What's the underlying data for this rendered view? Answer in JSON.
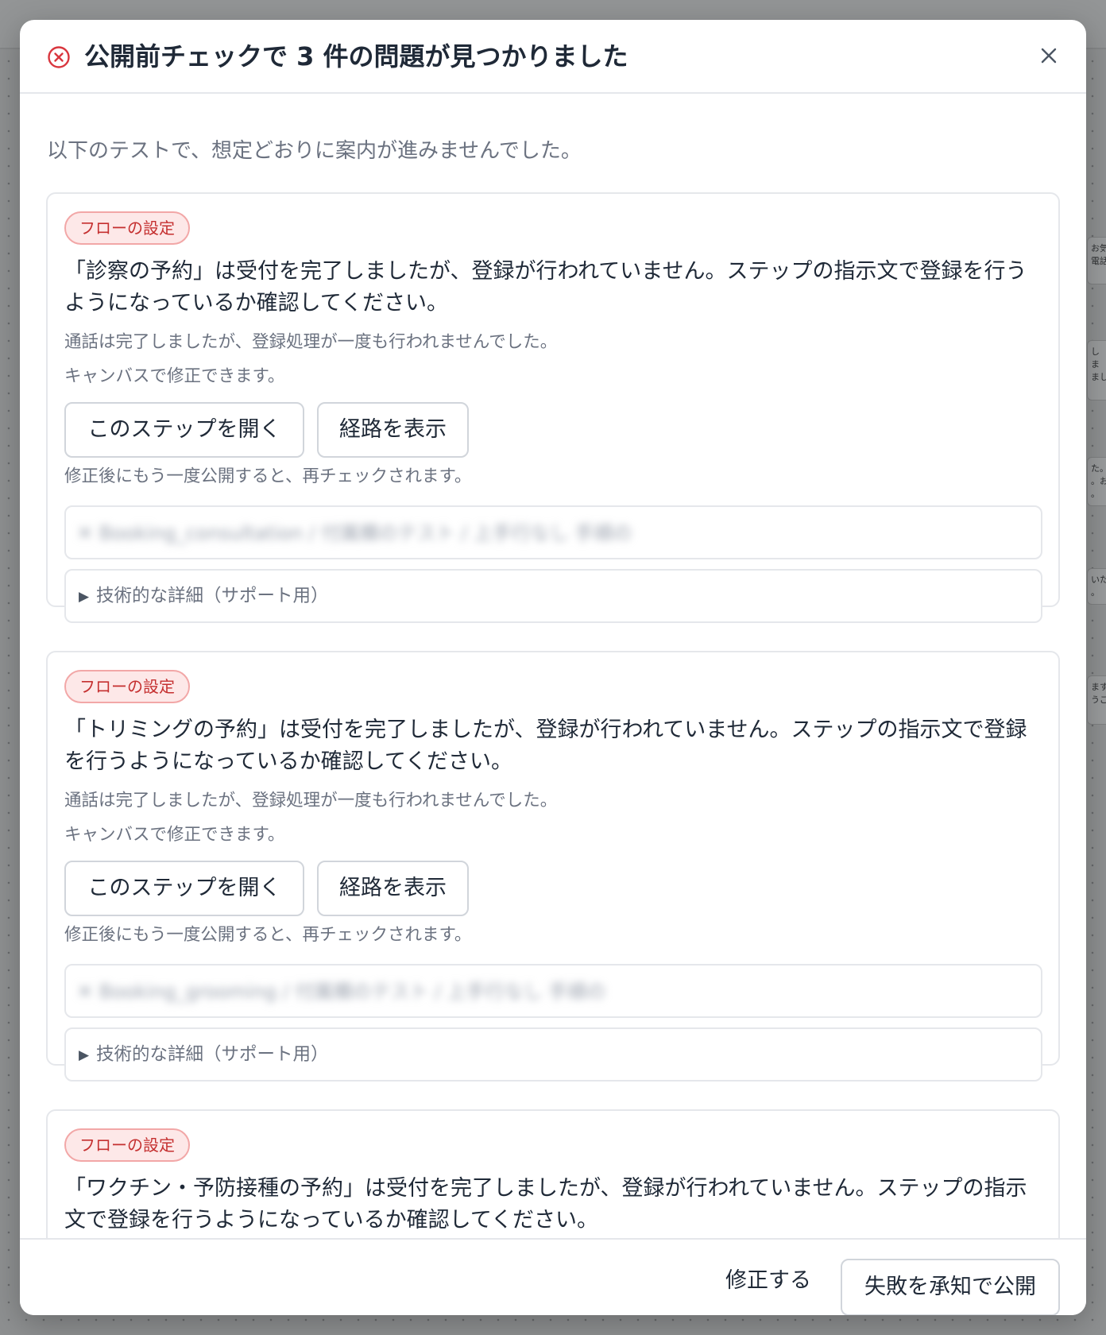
{
  "background": {
    "side_cards": [
      {
        "lines": [
          "お気",
          "電話"
        ]
      },
      {
        "lines": [
          "し",
          "ま",
          "まし"
        ]
      },
      {
        "lines": [
          "た。",
          "。お",
          "。"
        ]
      },
      {
        "lines": [
          "いた",
          "。"
        ]
      },
      {
        "lines": [
          "ます",
          "うご"
        ]
      }
    ]
  },
  "modal": {
    "title": "公開前チェックで 3 件の問題が見つかりました",
    "close_icon": "close-icon",
    "error_icon": "circle-x-icon",
    "error_color": "#d9363e",
    "intro": "以下のテストで、想定どおりに案内が進みませんでした。",
    "issues": [
      {
        "badge": "フローの設定",
        "message": "「診察の予約」は受付を完了しましたが、登録が行われていません。ステップの指示文で登録を行うようになっているか確認してください。",
        "detail_1": "通話は完了しましたが、登録処理が一度も行われませんでした。",
        "detail_2": "キャンバスで修正できます。",
        "open_step_label": "このステップを開く",
        "show_path_label": "経路を表示",
        "recheck_note": "修正後にもう一度公開すると、再チェックされます。",
        "blurred_text": "✕ Booking_consultation / 付属欄のテスト / 上手行なし 手順の",
        "tech_details_label": "技術的な詳細（サポート用）"
      },
      {
        "badge": "フローの設定",
        "message": "「トリミングの予約」は受付を完了しましたが、登録が行われていません。ステップの指示文で登録を行うようになっているか確認してください。",
        "detail_1": "通話は完了しましたが、登録処理が一度も行われませんでした。",
        "detail_2": "キャンバスで修正できます。",
        "open_step_label": "このステップを開く",
        "show_path_label": "経路を表示",
        "recheck_note": "修正後にもう一度公開すると、再チェックされます。",
        "blurred_text": "✕ Booking_grooming / 付属欄のテスト / 上手行なし 手順の",
        "tech_details_label": "技術的な詳細（サポート用）"
      },
      {
        "badge": "フローの設定",
        "message": "「ワクチン・予防接種の予約」は受付を完了しましたが、登録が行われていません。ステップの指示文で登録を行うようになっているか確認してください。"
      }
    ],
    "footer": {
      "fix_label": "修正する",
      "publish_label": "失敗を承知で公開"
    }
  }
}
